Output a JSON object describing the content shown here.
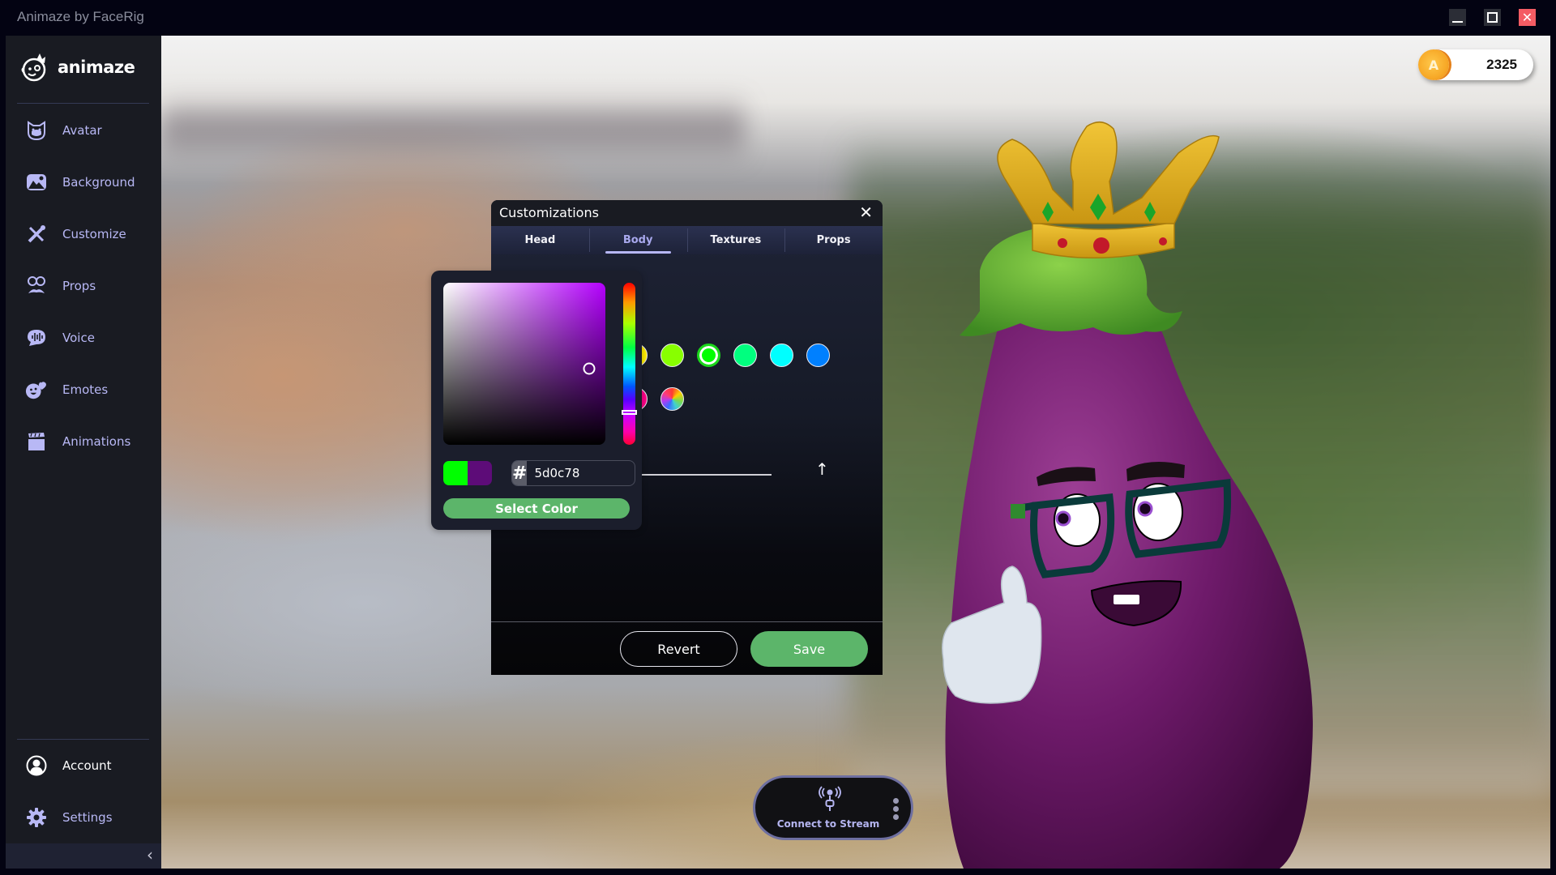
{
  "window": {
    "title": "Animaze by FaceRig",
    "controls": {
      "minimize": "minimize",
      "maximize": "maximize",
      "close": "✕"
    }
  },
  "sidebar": {
    "logo_text": "animaze",
    "items": [
      {
        "label": "Avatar",
        "icon": "avatar-icon"
      },
      {
        "label": "Background",
        "icon": "background-icon"
      },
      {
        "label": "Customize",
        "icon": "customize-icon"
      },
      {
        "label": "Props",
        "icon": "props-icon"
      },
      {
        "label": "Voice",
        "icon": "voice-icon"
      },
      {
        "label": "Emotes",
        "icon": "emotes-icon"
      },
      {
        "label": "Animations",
        "icon": "animations-icon"
      }
    ],
    "bottom_items": [
      {
        "label": "Account",
        "icon": "account-icon"
      },
      {
        "label": "Settings",
        "icon": "settings-icon"
      }
    ],
    "collapse_glyph": "‹"
  },
  "coins": {
    "icon_letter": "A",
    "count": "2325"
  },
  "dialog": {
    "title": "Customizations",
    "close_glyph": "✕",
    "tabs": [
      {
        "label": "Head",
        "active": false
      },
      {
        "label": "Body",
        "active": true
      },
      {
        "label": "Textures",
        "active": false
      },
      {
        "label": "Props",
        "active": false
      }
    ],
    "swatches_row1": [
      "#ffee00",
      "#88ff00",
      "#00ff00",
      "#00ff7f",
      "#00ffff",
      "#0080ff"
    ],
    "swatches_row2": [
      "#ff0088",
      "rainbow"
    ],
    "selected_swatch": "#00ff00",
    "slider_arrow": "↑",
    "revert_label": "Revert",
    "save_label": "Save"
  },
  "color_picker": {
    "hue_color": "#b400ff",
    "saturation": 0.9,
    "value": 0.47,
    "hue_position": 0.8,
    "previous_color": "#00ff00",
    "current_color": "#5d0c78",
    "hash_label": "#",
    "hex_value": "5d0c78",
    "select_label": "Select Color"
  },
  "stream": {
    "label": "Connect to Stream"
  },
  "colors": {
    "accent_green": "#5cb56a",
    "sidebar_text": "#b8b8f5",
    "active_tab": "#a9a9ee"
  }
}
